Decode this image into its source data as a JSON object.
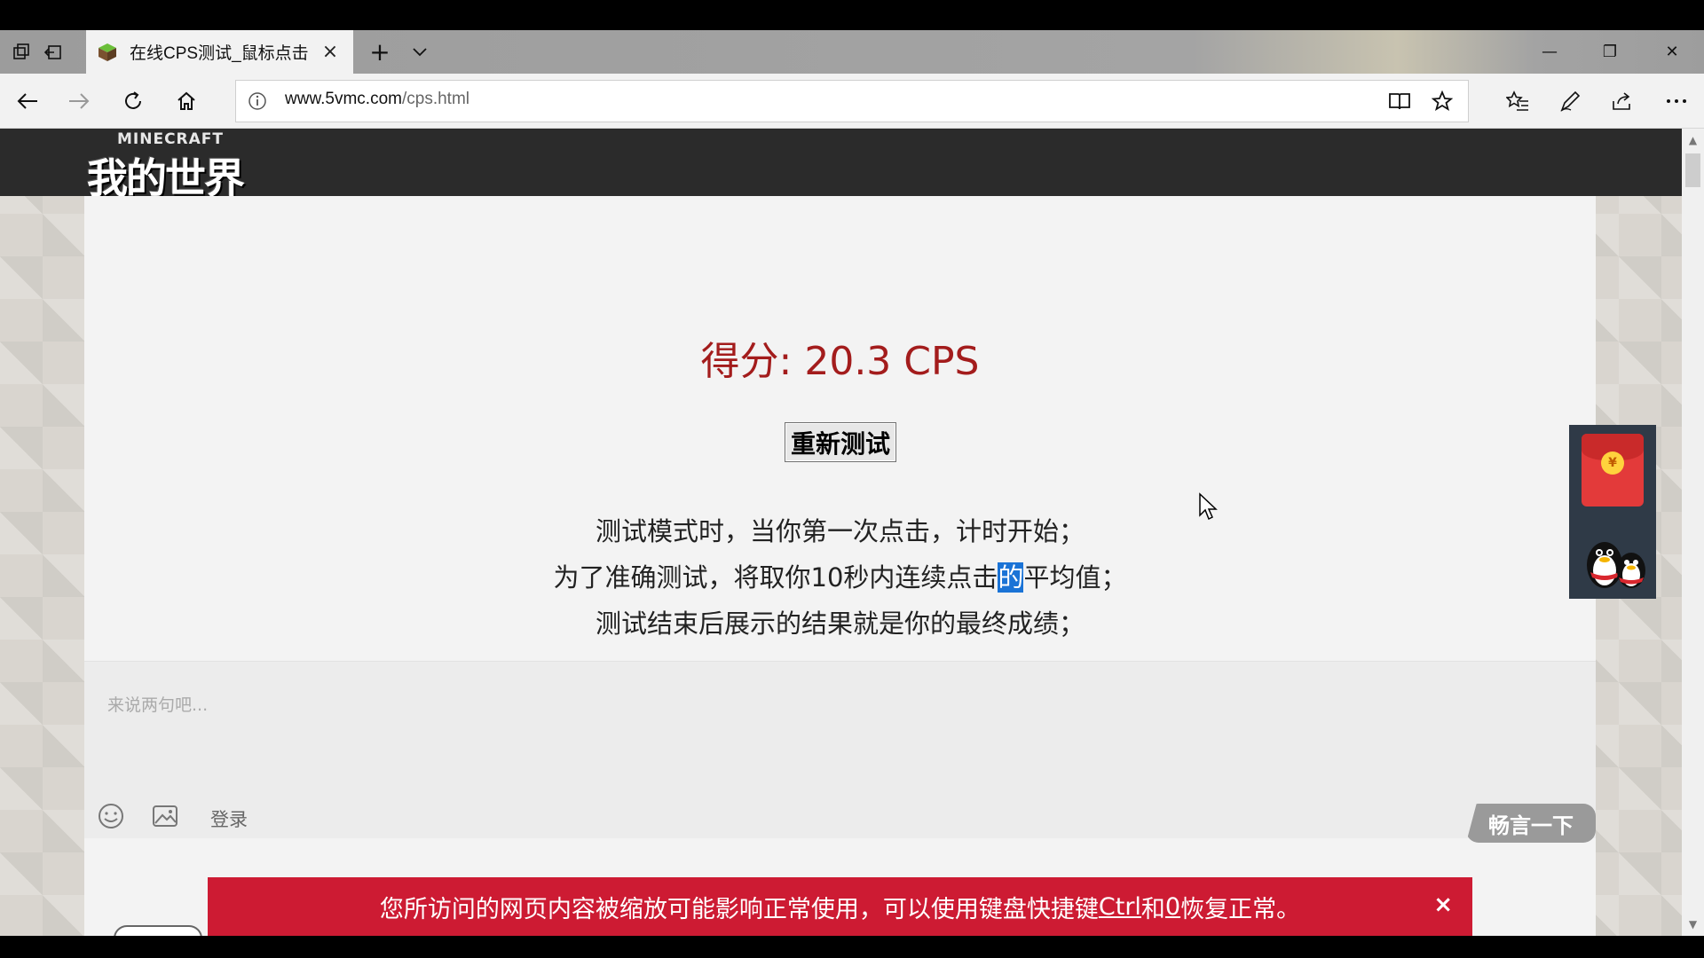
{
  "browser": {
    "tab": {
      "title": "在线CPS测试_鼠标点击",
      "close_label": "×"
    },
    "new_tab_label": "+",
    "window_controls": {
      "minimize": "—",
      "restore": "❐",
      "close": "✕"
    },
    "address": {
      "domain": "www.5vmc.com",
      "path": "/cps.html"
    }
  },
  "site": {
    "logo_small": "MINECRAFT",
    "logo_big": "我的世界"
  },
  "main": {
    "score": "得分: 20.3 CPS",
    "retest_label": "重新测试",
    "info_line1": "测试模式时，当你第一次点击，计时开始；",
    "info_line2_before": "为了准确测试，将取你10秒内连续点击",
    "info_line2_highlight": "的",
    "info_line2_after": "平均值；",
    "info_line3": "测试结束后展示的结果就是你的最终成绩；"
  },
  "comment": {
    "placeholder": "来说两句吧...",
    "login_label": "登录",
    "submit_label": "畅言一下"
  },
  "alert": {
    "text_before": "您所访问的网页内容被缩放可能影响正常使用，可以使用键盘快捷键 ",
    "key1": "Ctrl",
    "text_mid": " 和 ",
    "key2": "0",
    "text_after": " 恢复正常。",
    "close_label": "×"
  },
  "float_widget": {
    "coin_symbol": "¥"
  },
  "colors": {
    "score": "#a31c1c",
    "alert_bg": "#cd1b33",
    "highlight": "#1a73d6"
  }
}
